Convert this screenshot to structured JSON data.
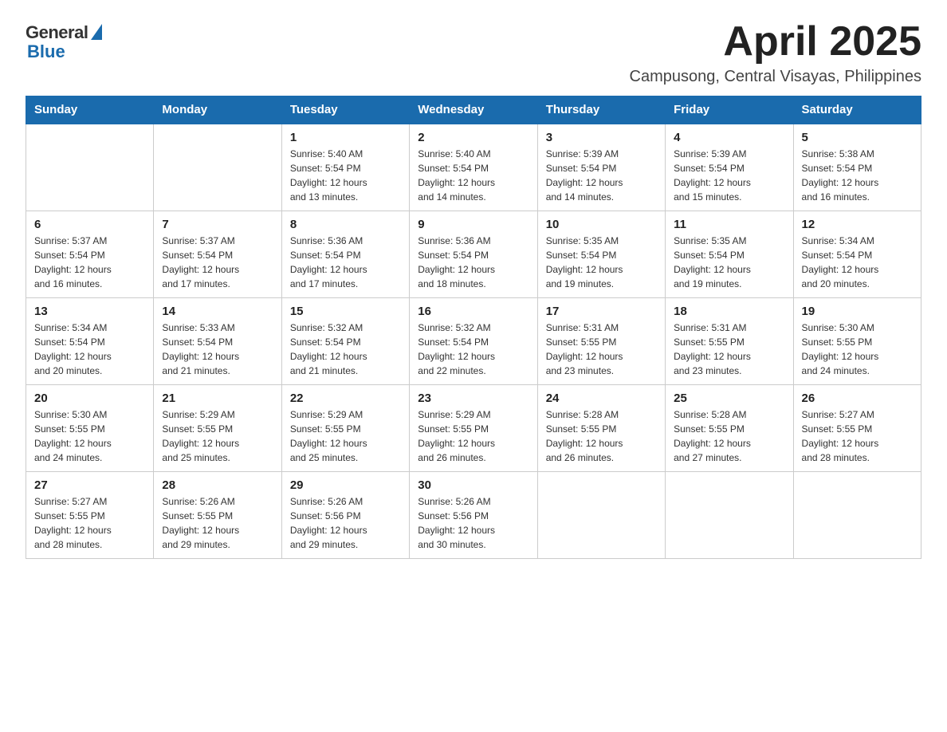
{
  "logo": {
    "general": "General",
    "blue": "Blue"
  },
  "title": "April 2025",
  "subtitle": "Campusong, Central Visayas, Philippines",
  "weekdays": [
    "Sunday",
    "Monday",
    "Tuesday",
    "Wednesday",
    "Thursday",
    "Friday",
    "Saturday"
  ],
  "weeks": [
    [
      {
        "day": "",
        "info": ""
      },
      {
        "day": "",
        "info": ""
      },
      {
        "day": "1",
        "info": "Sunrise: 5:40 AM\nSunset: 5:54 PM\nDaylight: 12 hours\nand 13 minutes."
      },
      {
        "day": "2",
        "info": "Sunrise: 5:40 AM\nSunset: 5:54 PM\nDaylight: 12 hours\nand 14 minutes."
      },
      {
        "day": "3",
        "info": "Sunrise: 5:39 AM\nSunset: 5:54 PM\nDaylight: 12 hours\nand 14 minutes."
      },
      {
        "day": "4",
        "info": "Sunrise: 5:39 AM\nSunset: 5:54 PM\nDaylight: 12 hours\nand 15 minutes."
      },
      {
        "day": "5",
        "info": "Sunrise: 5:38 AM\nSunset: 5:54 PM\nDaylight: 12 hours\nand 16 minutes."
      }
    ],
    [
      {
        "day": "6",
        "info": "Sunrise: 5:37 AM\nSunset: 5:54 PM\nDaylight: 12 hours\nand 16 minutes."
      },
      {
        "day": "7",
        "info": "Sunrise: 5:37 AM\nSunset: 5:54 PM\nDaylight: 12 hours\nand 17 minutes."
      },
      {
        "day": "8",
        "info": "Sunrise: 5:36 AM\nSunset: 5:54 PM\nDaylight: 12 hours\nand 17 minutes."
      },
      {
        "day": "9",
        "info": "Sunrise: 5:36 AM\nSunset: 5:54 PM\nDaylight: 12 hours\nand 18 minutes."
      },
      {
        "day": "10",
        "info": "Sunrise: 5:35 AM\nSunset: 5:54 PM\nDaylight: 12 hours\nand 19 minutes."
      },
      {
        "day": "11",
        "info": "Sunrise: 5:35 AM\nSunset: 5:54 PM\nDaylight: 12 hours\nand 19 minutes."
      },
      {
        "day": "12",
        "info": "Sunrise: 5:34 AM\nSunset: 5:54 PM\nDaylight: 12 hours\nand 20 minutes."
      }
    ],
    [
      {
        "day": "13",
        "info": "Sunrise: 5:34 AM\nSunset: 5:54 PM\nDaylight: 12 hours\nand 20 minutes."
      },
      {
        "day": "14",
        "info": "Sunrise: 5:33 AM\nSunset: 5:54 PM\nDaylight: 12 hours\nand 21 minutes."
      },
      {
        "day": "15",
        "info": "Sunrise: 5:32 AM\nSunset: 5:54 PM\nDaylight: 12 hours\nand 21 minutes."
      },
      {
        "day": "16",
        "info": "Sunrise: 5:32 AM\nSunset: 5:54 PM\nDaylight: 12 hours\nand 22 minutes."
      },
      {
        "day": "17",
        "info": "Sunrise: 5:31 AM\nSunset: 5:55 PM\nDaylight: 12 hours\nand 23 minutes."
      },
      {
        "day": "18",
        "info": "Sunrise: 5:31 AM\nSunset: 5:55 PM\nDaylight: 12 hours\nand 23 minutes."
      },
      {
        "day": "19",
        "info": "Sunrise: 5:30 AM\nSunset: 5:55 PM\nDaylight: 12 hours\nand 24 minutes."
      }
    ],
    [
      {
        "day": "20",
        "info": "Sunrise: 5:30 AM\nSunset: 5:55 PM\nDaylight: 12 hours\nand 24 minutes."
      },
      {
        "day": "21",
        "info": "Sunrise: 5:29 AM\nSunset: 5:55 PM\nDaylight: 12 hours\nand 25 minutes."
      },
      {
        "day": "22",
        "info": "Sunrise: 5:29 AM\nSunset: 5:55 PM\nDaylight: 12 hours\nand 25 minutes."
      },
      {
        "day": "23",
        "info": "Sunrise: 5:29 AM\nSunset: 5:55 PM\nDaylight: 12 hours\nand 26 minutes."
      },
      {
        "day": "24",
        "info": "Sunrise: 5:28 AM\nSunset: 5:55 PM\nDaylight: 12 hours\nand 26 minutes."
      },
      {
        "day": "25",
        "info": "Sunrise: 5:28 AM\nSunset: 5:55 PM\nDaylight: 12 hours\nand 27 minutes."
      },
      {
        "day": "26",
        "info": "Sunrise: 5:27 AM\nSunset: 5:55 PM\nDaylight: 12 hours\nand 28 minutes."
      }
    ],
    [
      {
        "day": "27",
        "info": "Sunrise: 5:27 AM\nSunset: 5:55 PM\nDaylight: 12 hours\nand 28 minutes."
      },
      {
        "day": "28",
        "info": "Sunrise: 5:26 AM\nSunset: 5:55 PM\nDaylight: 12 hours\nand 29 minutes."
      },
      {
        "day": "29",
        "info": "Sunrise: 5:26 AM\nSunset: 5:56 PM\nDaylight: 12 hours\nand 29 minutes."
      },
      {
        "day": "30",
        "info": "Sunrise: 5:26 AM\nSunset: 5:56 PM\nDaylight: 12 hours\nand 30 minutes."
      },
      {
        "day": "",
        "info": ""
      },
      {
        "day": "",
        "info": ""
      },
      {
        "day": "",
        "info": ""
      }
    ]
  ]
}
